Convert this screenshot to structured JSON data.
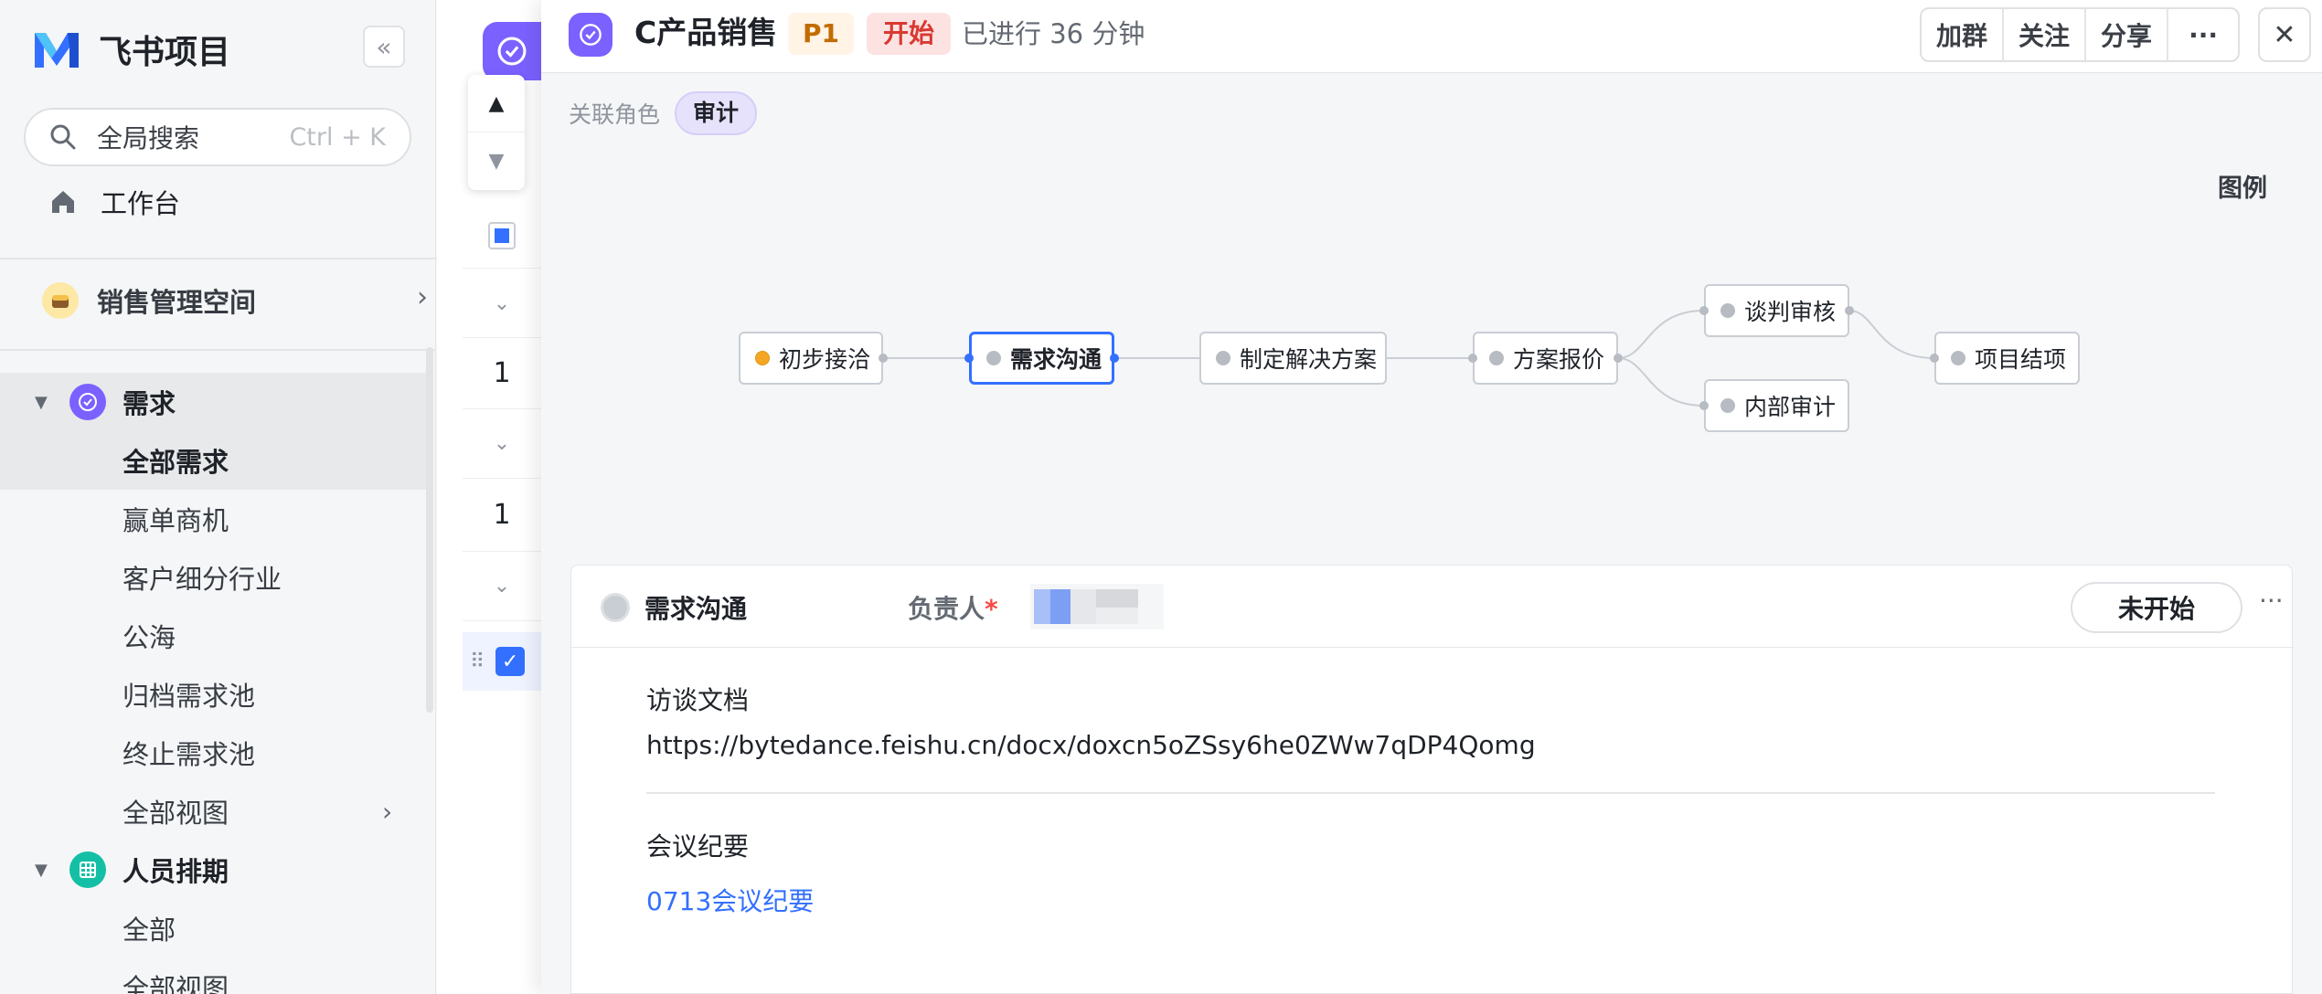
{
  "sidebar": {
    "brand": "飞书项目",
    "search": {
      "label": "全局搜索",
      "shortcut": "Ctrl + K"
    },
    "workbench": "工作台",
    "space": "销售管理空间",
    "groups": [
      {
        "label": "需求",
        "items": [
          "全部需求",
          "赢单商机",
          "客户细分行业",
          "公海",
          "归档需求池",
          "终止需求池",
          "全部视图"
        ]
      },
      {
        "label": "人员排期",
        "items": [
          "全部",
          "全部视图"
        ]
      }
    ]
  },
  "list": {
    "row_numbers": [
      "1",
      "1"
    ]
  },
  "header": {
    "title": "C产品销售",
    "priority": "P1",
    "status": "开始",
    "elapsed": "已进行 36 分钟",
    "actions": [
      "加群",
      "关注",
      "分享",
      "···"
    ],
    "close": "✕"
  },
  "role": {
    "label": "关联角色",
    "tag": "审计"
  },
  "legend": "图例",
  "flow": {
    "nodes": [
      "初步接洽",
      "需求沟通",
      "制定解决方案",
      "方案报价",
      "谈判审核",
      "内部审计",
      "项目结项"
    ]
  },
  "task": {
    "title": "需求沟通",
    "owner_label": "负责人",
    "required_mark": "*",
    "status_button": "未开始",
    "more": "···",
    "fields": [
      {
        "label": "访谈文档",
        "value": "https://bytedance.feishu.cn/docx/doxcn5oZSsy6he0ZWw7qDP4Qomg"
      },
      {
        "label": "会议纪要",
        "value": "0713会议纪要"
      }
    ]
  },
  "colors": {
    "accent": "#3370ff",
    "app_purple": "#7b61ff",
    "start_red": "#d83931",
    "p1_orange": "#c16c00"
  }
}
